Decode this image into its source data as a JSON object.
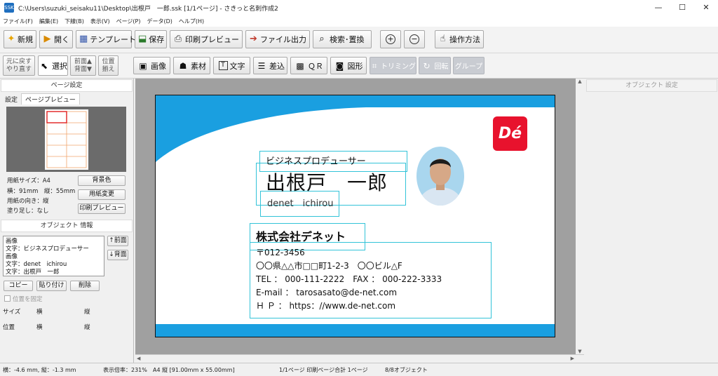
{
  "window": {
    "title": "C:\\Users\\suzuki_seisaku11\\Desktop\\出根戸　一郎.ssk  [1/1ページ] - さきっと名刺作成2",
    "minimize": "—",
    "maximize": "☐",
    "close": "✕"
  },
  "menu": [
    "ファイル(F)",
    "編集(E)",
    "下線(B)",
    "表示(V)",
    "ページ(P)",
    "データ(D)",
    "ヘルプ(H)"
  ],
  "toolbar1": {
    "new": "新規",
    "open": "開く",
    "template": "テンプレート",
    "save": "保存",
    "print_preview": "印刷プレビュー",
    "file_output": "ファイル出力",
    "search_replace": "検索･置換",
    "zoom_in": "+",
    "zoom_out": "−",
    "help": "操作方法"
  },
  "toolbar2": {
    "undo": "元に戻す",
    "redo": "やり直す",
    "select": "選択",
    "front": "前面▲",
    "back": "背面▼",
    "position1": "位置",
    "position2": "揃え",
    "image": "画像",
    "material": "素材",
    "text": "文字",
    "merge": "差込",
    "qr": "ＱＲ",
    "shape": "図形",
    "trimming": "トリミング",
    "rotate": "回転",
    "group": "グループ"
  },
  "page_settings": {
    "header": "ページ設定",
    "tab_settings": "設定",
    "tab_preview": "ページプレビュー",
    "paper_size": "用紙サイズ：A4",
    "dimensions": "横：91mm　縦：55mm",
    "orientation": "用紙の向き：縦",
    "bleed": "塗り足し：なし",
    "bg_color_btn": "背景色",
    "change_paper_btn": "用紙変更",
    "print_preview_btn": "印刷プレビュー"
  },
  "object_info": {
    "header": "オブジェクト 情報",
    "list": [
      "画像",
      "文字：ビジネスプロデューサー",
      "画像",
      "文字：denet　ichirou",
      "文字：出根戸　一郎"
    ],
    "to_front": "↑前面",
    "to_back": "↓背面",
    "copy": "コピー",
    "paste": "貼り付け",
    "delete": "削除",
    "lock_position": "位置を固定",
    "size_label": "サイズ",
    "pos_label": "位置",
    "horiz": "横",
    "vert": "縦"
  },
  "object_settings": {
    "header": "オブジェクト 設定"
  },
  "card": {
    "job_title": "ビジネスプロデューサー",
    "name": "出根戸　一郎",
    "name_romaji": "denet　ichirou",
    "company": "株式会社デネット",
    "postal": "〒012-3456",
    "address": "〇〇県△△市□□町1-2-3　〇〇ビル△F",
    "tel_fax": "TEL ： 000-111-2222　FAX ： 000-222-3333",
    "email": "E-mail ： tarosasato@de-net.com",
    "hp": "Ｈ Ｐ ： https：//www.de-net.com",
    "logo": "Dé",
    "accent_color": "#1a9fe0",
    "logo_color": "#e8122d"
  },
  "status": {
    "coords": "横：-4.6 mm, 縦：-1.3 mm",
    "zoom": "表示倍率：231%",
    "paper": "A4 縦 [91.00mm x 55.00mm]",
    "pages": "1/1ページ 印刷ページ合計 1ページ",
    "objects": "8/8オブジェクト"
  }
}
